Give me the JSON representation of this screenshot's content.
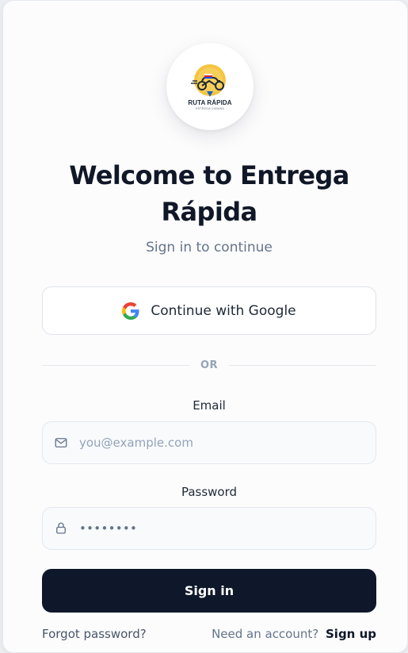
{
  "brand": {
    "name": "RUTA RÁPIDA",
    "tagline": "ENTREGA CUBANA"
  },
  "header": {
    "title": "Welcome to Entrega Rápida",
    "subtitle": "Sign in to continue"
  },
  "auth": {
    "google_label": "Continue with Google",
    "divider_label": "OR",
    "email_label": "Email",
    "email_placeholder": "you@example.com",
    "email_value": "",
    "password_label": "Password",
    "password_value": "••••••••",
    "signin_label": "Sign in"
  },
  "footer": {
    "forgot_label": "Forgot password?",
    "need_account_label": "Need an account?",
    "signup_label": "Sign up"
  },
  "colors": {
    "primary": "#0f172a",
    "muted": "#64748b",
    "border": "#e3e7ed"
  },
  "icons": {
    "google": "google-icon",
    "email": "mail-icon",
    "password": "lock-icon"
  }
}
